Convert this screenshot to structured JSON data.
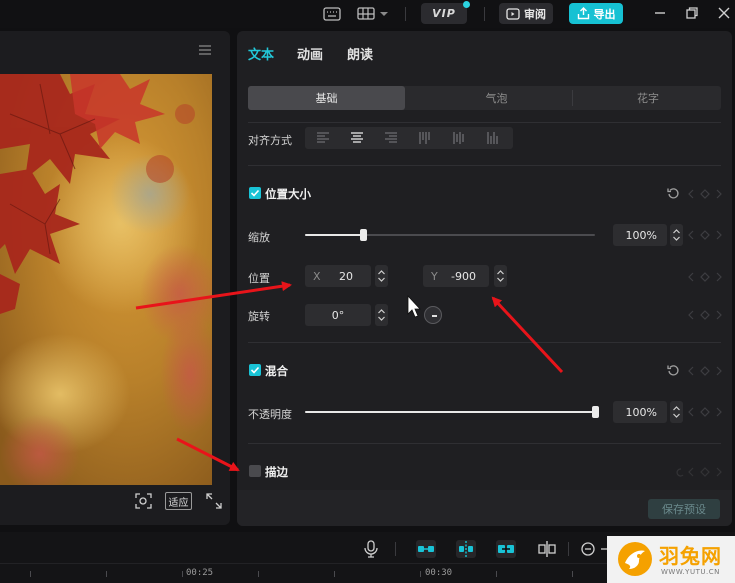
{
  "topbar": {
    "vip_label": "VIP",
    "review_label": "审阅",
    "export_label": "导出"
  },
  "player": {
    "fit_label": "适应"
  },
  "panel": {
    "tabs": [
      {
        "label": "文本",
        "active": true
      },
      {
        "label": "动画",
        "active": false
      },
      {
        "label": "朗读",
        "active": false
      }
    ],
    "style_tabs": [
      {
        "label": "基础",
        "active": true
      },
      {
        "label": "气泡",
        "active": false
      },
      {
        "label": "花字",
        "active": false
      }
    ],
    "align_label": "对齐方式",
    "position_size": {
      "title": "位置大小",
      "checked": true,
      "scale_label": "缩放",
      "scale_value": "100%",
      "scale_fraction": 0.2,
      "position_label": "位置",
      "x_prefix": "X",
      "x_value": "20",
      "y_prefix": "Y",
      "y_value": "-900",
      "rotate_label": "旋转",
      "rotate_value": "0°"
    },
    "blend": {
      "title": "混合",
      "checked": true,
      "opacity_label": "不透明度",
      "opacity_value": "100%",
      "opacity_fraction": 1.0
    },
    "stroke": {
      "title": "描边",
      "checked": false
    },
    "save_preset_label": "保存预设"
  },
  "timeline": {
    "ticks": [
      "00:25",
      "00:30"
    ]
  },
  "watermark": {
    "name": "羽兔网",
    "url": "WWW.YUTU.CN"
  },
  "colors": {
    "accent": "#19c3d6",
    "annotation": "#e8141a"
  }
}
